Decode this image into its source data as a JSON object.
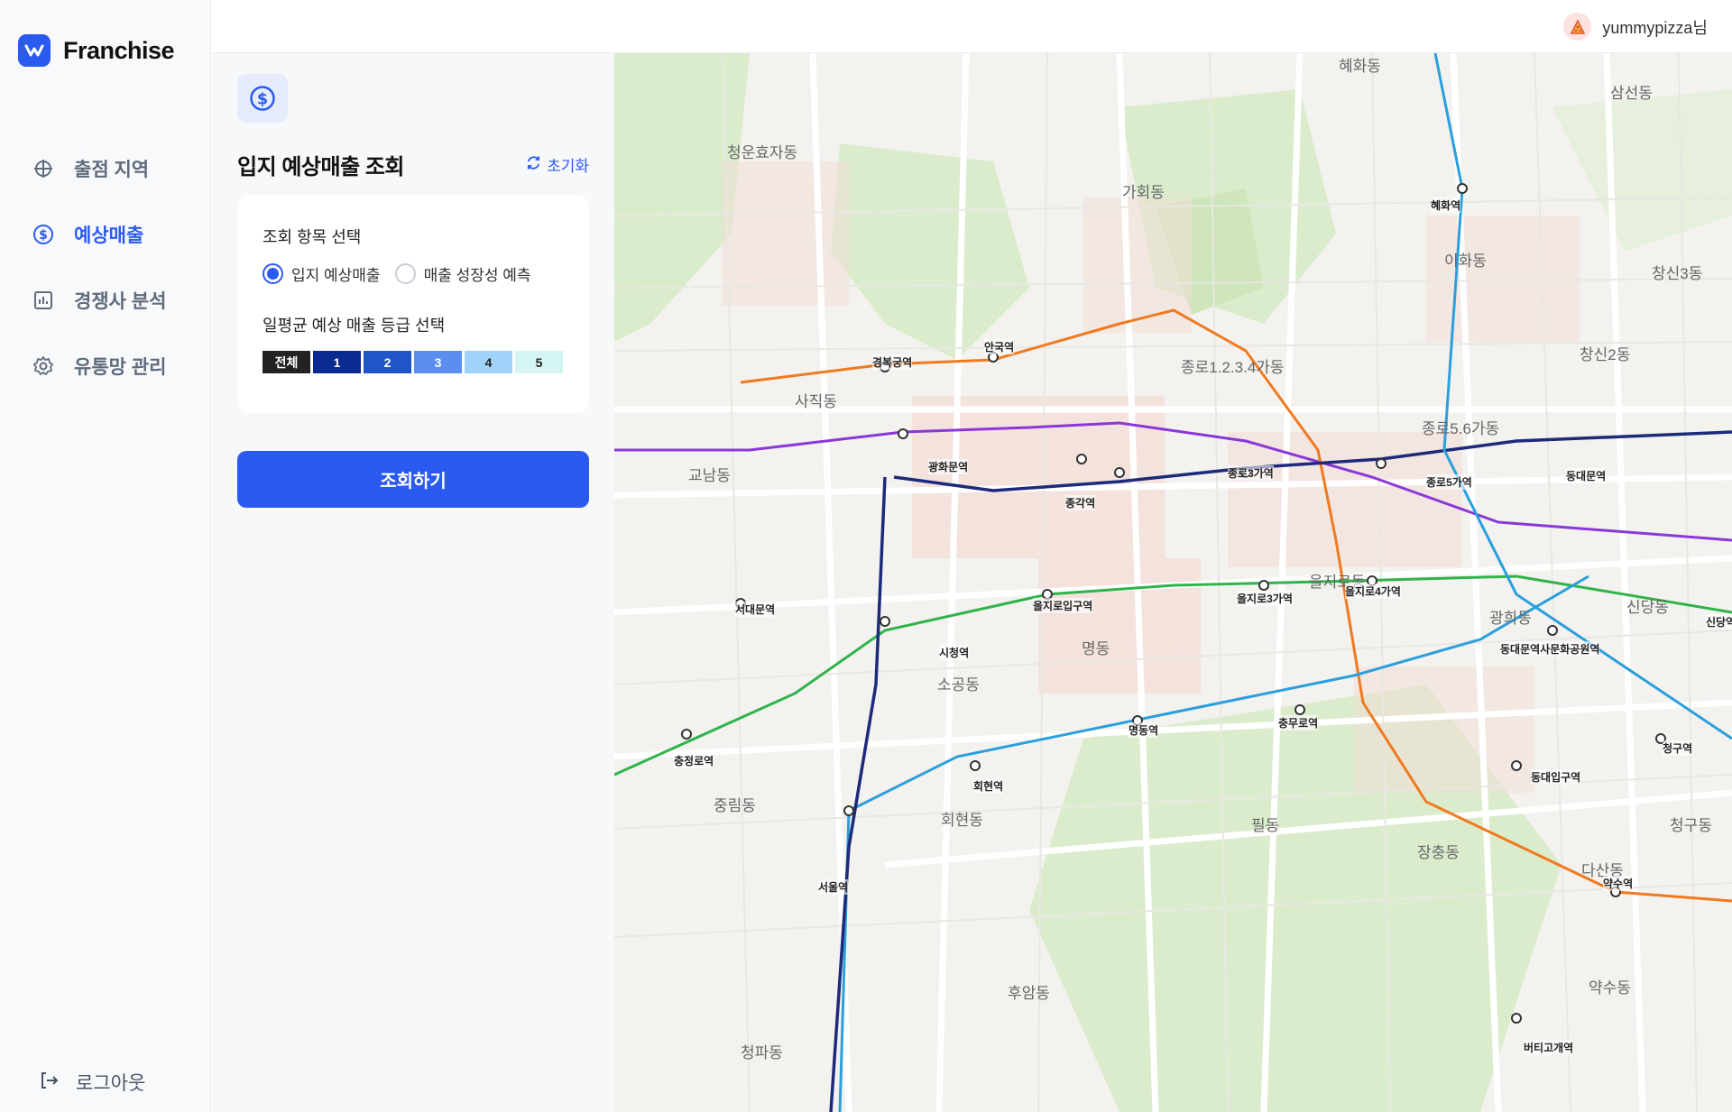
{
  "app": {
    "name": "Franchise"
  },
  "nav": {
    "items": [
      {
        "label": "출점 지역",
        "icon": "crosshair-icon",
        "active": false
      },
      {
        "label": "예상매출",
        "icon": "dollar-circle-icon",
        "active": true
      },
      {
        "label": "경쟁사 분석",
        "icon": "bar-chart-icon",
        "active": false
      },
      {
        "label": "유통망 관리",
        "icon": "gear-icon",
        "active": false
      }
    ],
    "logout_label": "로그아웃"
  },
  "topbar": {
    "user_name": "yummypizza님",
    "avatar_icon": "pizza-icon"
  },
  "panel": {
    "title": "입지 예상매출 조회",
    "reset_label": "초기화",
    "section1_title": "조회 항목 선택",
    "options": [
      {
        "label": "입지 예상매출",
        "checked": true
      },
      {
        "label": "매출 성장성 예측",
        "checked": false
      }
    ],
    "section2_title": "일평균 예상 매출 등급 선택",
    "grades": [
      {
        "label": "전체",
        "bg": "#222222",
        "fg": "#ffffff"
      },
      {
        "label": "1",
        "bg": "#0b2a8f",
        "fg": "#ffffff"
      },
      {
        "label": "2",
        "bg": "#1f55c8",
        "fg": "#ffffff"
      },
      {
        "label": "3",
        "bg": "#5b8ef0",
        "fg": "#ffffff"
      },
      {
        "label": "4",
        "bg": "#9fd3fa",
        "fg": "#222222"
      },
      {
        "label": "5",
        "bg": "#d4f5f2",
        "fg": "#222222"
      }
    ],
    "submit_label": "조회하기"
  },
  "map": {
    "areas": [
      "청운효자동",
      "가회동",
      "혜화동",
      "삼선동",
      "이화동",
      "창신2동",
      "창신3동",
      "종로1.2.3.4가동",
      "종로5.6가동",
      "사직동",
      "교남동",
      "명동",
      "을지로동",
      "광희동",
      "소공동",
      "회현동",
      "필동",
      "장충동",
      "다산동",
      "신당동",
      "중림동",
      "후암동",
      "청파동",
      "약수동",
      "청구동"
    ],
    "stations": [
      "경복궁역",
      "안국역",
      "혜화역",
      "종로3가역",
      "종각역",
      "종로5가역",
      "동대문역",
      "광화문역",
      "시청역",
      "을지로입구역",
      "을지로3가역",
      "을지로4가역",
      "동대문역사문화공원역",
      "서대문역",
      "충정로역",
      "서울역",
      "회현역",
      "명동역",
      "충무로역",
      "동대입구역",
      "약수역",
      "버티고개역",
      "청구역",
      "신당역"
    ],
    "colors": {
      "line1": "#1d2a7a",
      "line2": "#2fb34a",
      "line3": "#f07a20",
      "line4": "#2b9fdc",
      "line5": "#8a38d8",
      "park": "#dbeccc",
      "road": "#ffffff",
      "block": "#f4dcd6"
    }
  }
}
